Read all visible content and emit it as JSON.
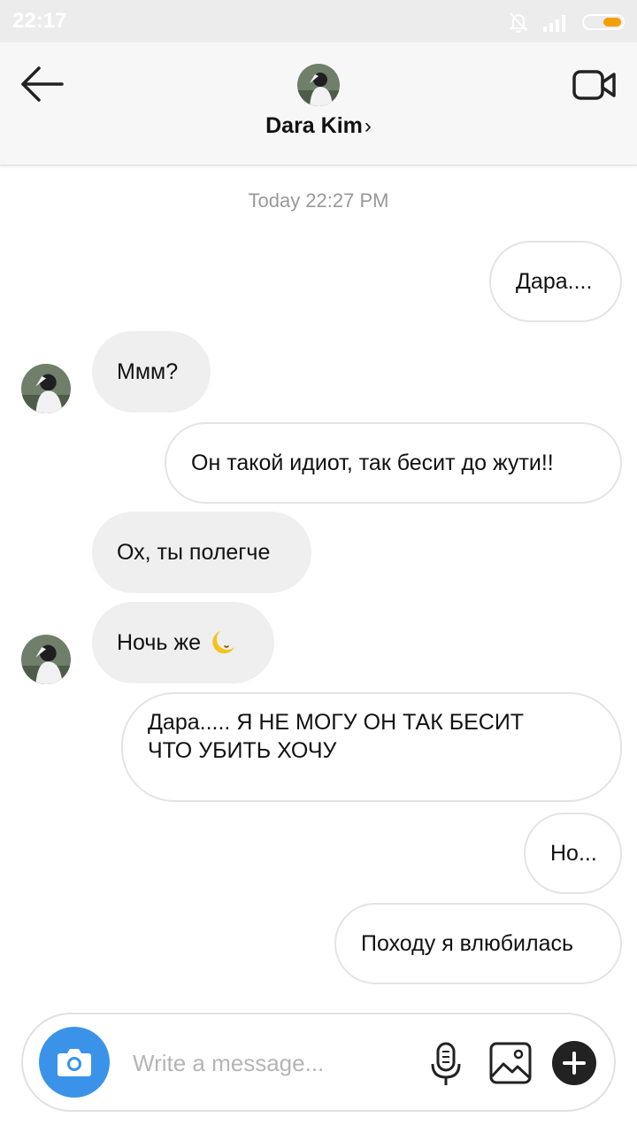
{
  "status_bar": {
    "time": "22:17"
  },
  "header": {
    "name": "Dara Kim",
    "chevron": "›"
  },
  "timestamp": "Today 22:27 PM",
  "messages": [
    {
      "direction": "out",
      "text": "Дара...."
    },
    {
      "direction": "in",
      "text": "Ммм?"
    },
    {
      "direction": "out",
      "text": "Он такой идиот, так бесит до жути!!"
    },
    {
      "direction": "in",
      "text": "Ох, ты полегче"
    },
    {
      "direction": "in",
      "text": "Ночь же",
      "emoji": "🌜"
    },
    {
      "direction": "out",
      "text": "Дара..... Я НЕ МОГУ ОН ТАК БЕСИТ ЧТО УБИТЬ ХОЧУ"
    },
    {
      "direction": "out",
      "text": "Но..."
    },
    {
      "direction": "out",
      "text": "Походу я влюбилась"
    }
  ],
  "composer": {
    "placeholder": "Write a message..."
  },
  "colors": {
    "accent": "#3a93e8",
    "battery": "#f5a000"
  },
  "icons": [
    "back-arrow-icon",
    "video-call-icon",
    "camera-icon",
    "microphone-icon",
    "gallery-icon",
    "plus-icon",
    "bell-off-icon",
    "signal-icon",
    "battery-icon",
    "moon-emoji"
  ]
}
